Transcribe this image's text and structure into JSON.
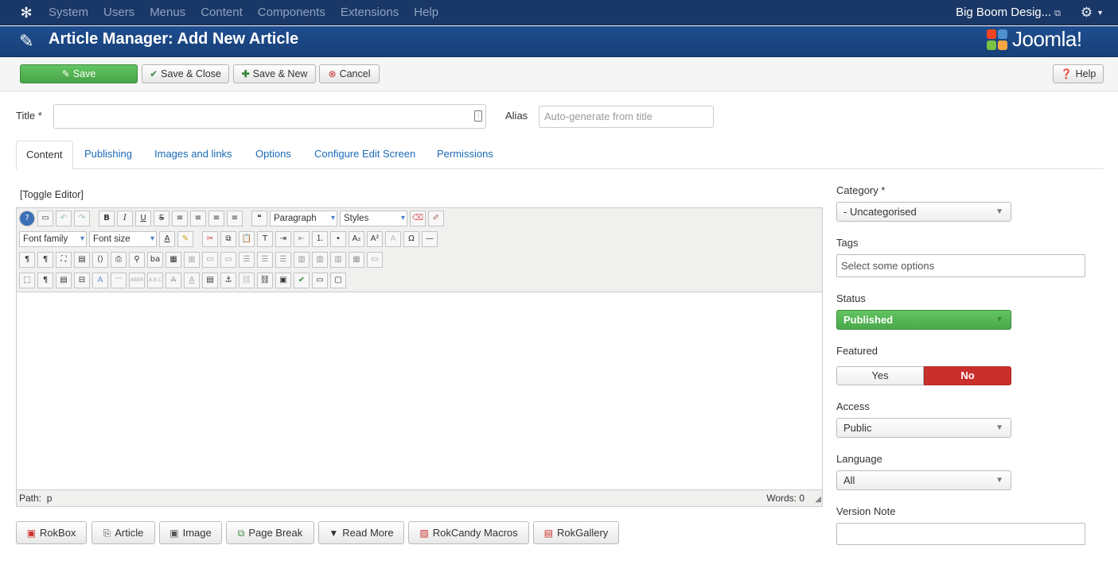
{
  "topnav": {
    "logo_icon": "joomla-icon",
    "menu": [
      "System",
      "Users",
      "Menus",
      "Content",
      "Components",
      "Extensions",
      "Help"
    ],
    "site_name": "Big Boom Desig...",
    "site_icon": "external-link-icon",
    "settings_icon": "gear-icon"
  },
  "header": {
    "title": "Article Manager: Add New Article",
    "title_icon": "pencil-icon",
    "brand": "Joomla!"
  },
  "toolbar": {
    "save": "Save",
    "save_close": "Save & Close",
    "save_new": "Save & New",
    "cancel": "Cancel",
    "help": "Help"
  },
  "form": {
    "title_label": "Title *",
    "title_value": "",
    "alias_label": "Alias",
    "alias_placeholder": "Auto-generate from title"
  },
  "tabs": [
    "Content",
    "Publishing",
    "Images and links",
    "Options",
    "Configure Edit Screen",
    "Permissions"
  ],
  "editor": {
    "toggle": "[Toggle Editor]",
    "format_select": "Paragraph",
    "styles_select": "Styles",
    "font_family": "Font family",
    "font_size": "Font size",
    "path_label": "Path:",
    "path_value": "p",
    "words": "Words: 0"
  },
  "extra_buttons": [
    "RokBox",
    "Article",
    "Image",
    "Page Break",
    "Read More",
    "RokCandy Macros",
    "RokGallery"
  ],
  "sidebar": {
    "category_label": "Category *",
    "category_value": "- Uncategorised",
    "tags_label": "Tags",
    "tags_placeholder": "Select some options",
    "status_label": "Status",
    "status_value": "Published",
    "featured_label": "Featured",
    "featured_yes": "Yes",
    "featured_no": "No",
    "access_label": "Access",
    "access_value": "Public",
    "language_label": "Language",
    "language_value": "All",
    "version_note_label": "Version Note",
    "version_note_value": ""
  },
  "colors": {
    "topnav_bg": "#1a3867",
    "header_bg": "#1f4d8f",
    "save_green": "#47a447",
    "no_red": "#c9302c",
    "link_blue": "#1b6ab5"
  }
}
